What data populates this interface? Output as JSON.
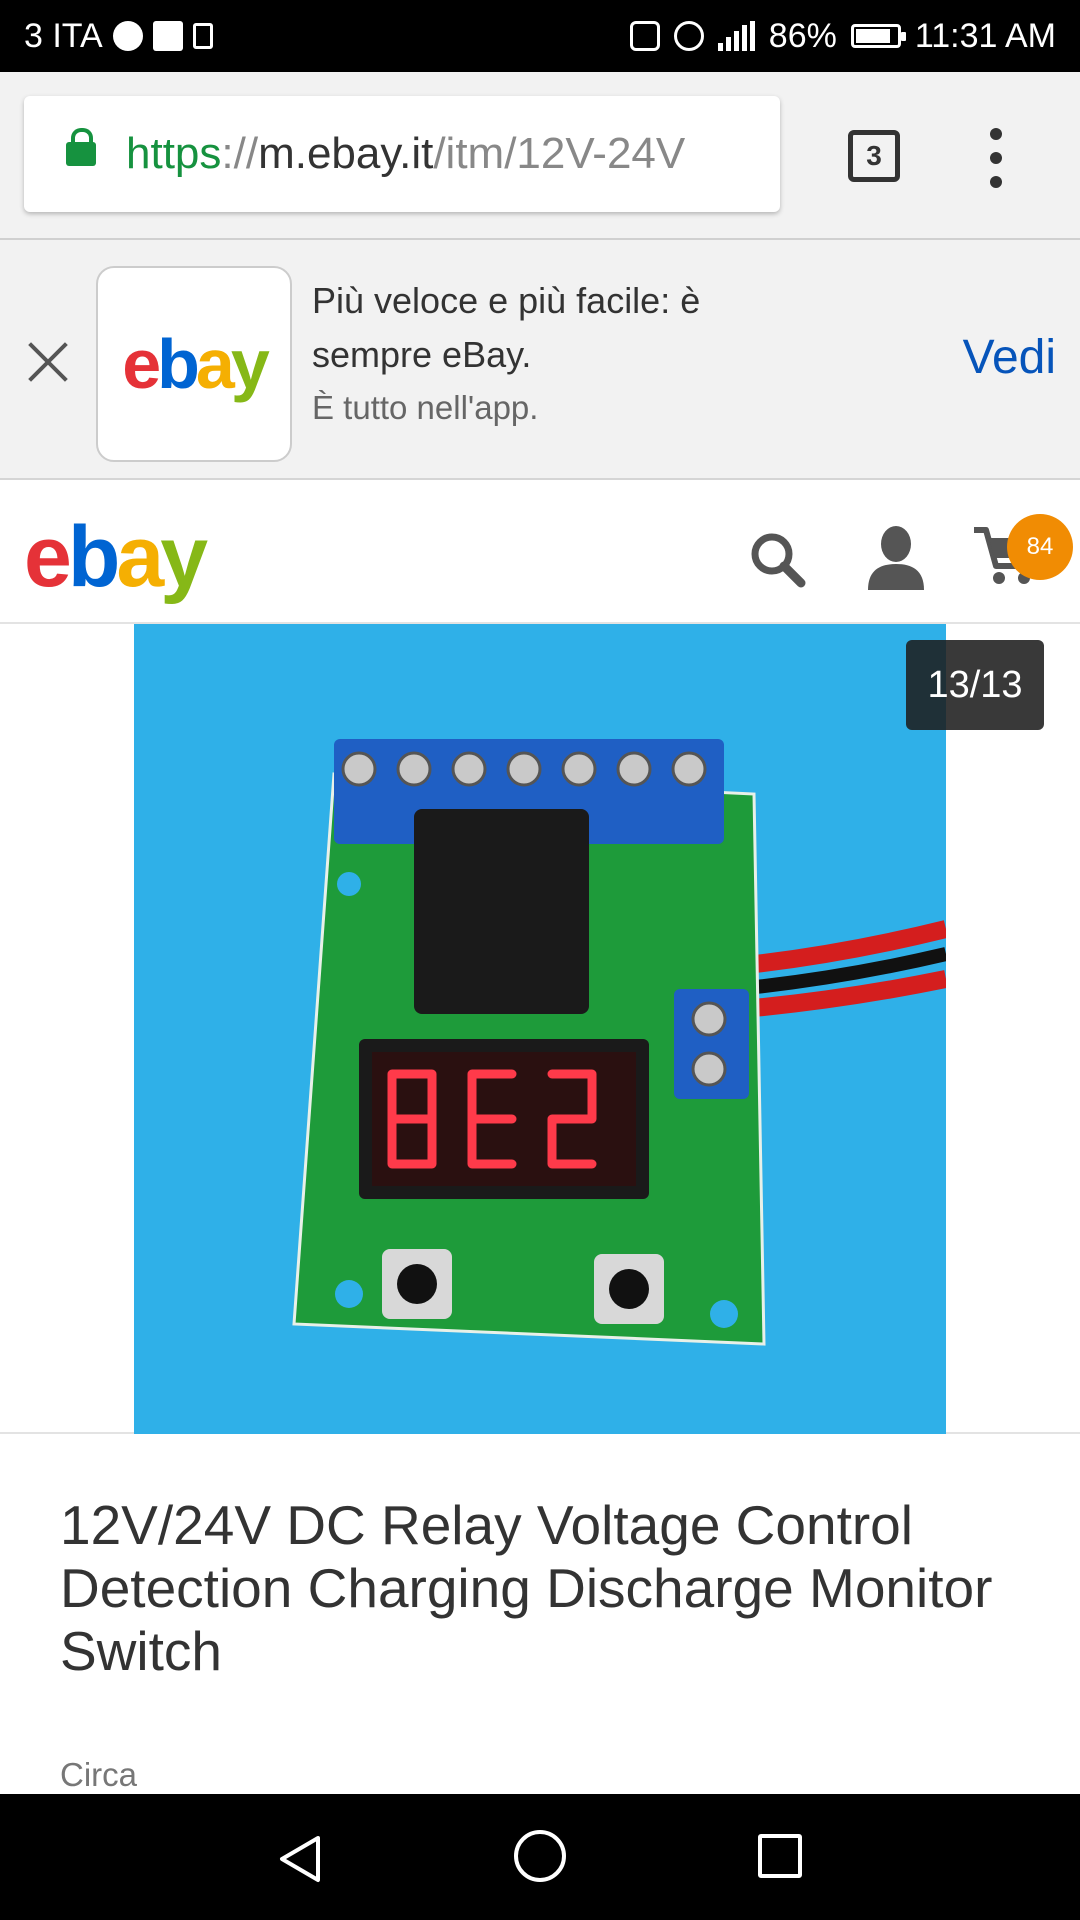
{
  "status_bar": {
    "carrier": "3 ITA",
    "battery": "86%",
    "battery_level": 0.86,
    "time": "11:31 AM",
    "icons": [
      "navigation-icon",
      "gmail-icon",
      "upload-icon",
      "nfc-icon",
      "alarm-icon",
      "signal-icon",
      "battery-icon"
    ]
  },
  "browser": {
    "url_scheme": "https",
    "url_sep": "://",
    "url_host": "m.ebay.it",
    "url_path": "/itm/12V-24V",
    "tab_count": "3"
  },
  "app_banner": {
    "line1": "Più veloce e più facile: è sempre eBay.",
    "line2": "È tutto nell'app.",
    "action": "Vedi",
    "logo": {
      "e": "e",
      "b": "b",
      "a": "a",
      "y": "y"
    }
  },
  "header": {
    "logo": {
      "e": "e",
      "b": "b",
      "a": "a",
      "y": "y"
    },
    "cart_count": "84"
  },
  "gallery": {
    "counter": "13/13"
  },
  "product": {
    "title": "12V/24V DC Relay Voltage Control Detection Charging Discharge Monitor Switch",
    "circa_label": "Circa"
  },
  "colors": {
    "ebay_red": "#e53238",
    "ebay_blue": "#0654ba",
    "ebay_yellow": "#f5af02",
    "ebay_green": "#86b817",
    "badge_orange": "#f18c03",
    "secure_green": "#16923f"
  }
}
